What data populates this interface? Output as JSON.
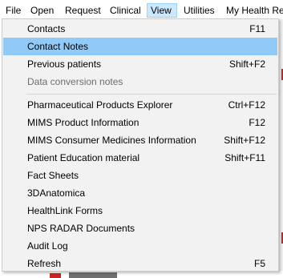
{
  "menubar": {
    "items": [
      "File",
      "Open",
      "Request",
      "Clinical",
      "View",
      "Utilities",
      "My Health Re"
    ]
  },
  "view_menu": {
    "items": [
      {
        "label": "Contacts",
        "shortcut": "F11"
      },
      {
        "label": "Contact Notes",
        "shortcut": ""
      },
      {
        "label": "Previous patients",
        "shortcut": "Shift+F2"
      },
      {
        "label": "Data conversion notes",
        "shortcut": ""
      },
      {
        "label": "Pharmaceutical Products Explorer",
        "shortcut": "Ctrl+F12"
      },
      {
        "label": "MIMS Product Information",
        "shortcut": "F12"
      },
      {
        "label": "MIMS Consumer Medicines Information",
        "shortcut": "Shift+F12"
      },
      {
        "label": "Patient Education material",
        "shortcut": "Shift+F11"
      },
      {
        "label": "Fact Sheets",
        "shortcut": ""
      },
      {
        "label": "3DAnatomica",
        "shortcut": ""
      },
      {
        "label": "HealthLink Forms",
        "shortcut": ""
      },
      {
        "label": "NPS RADAR Documents",
        "shortcut": ""
      },
      {
        "label": "Audit Log",
        "shortcut": ""
      },
      {
        "label": "Refresh",
        "shortcut": "F5"
      }
    ]
  },
  "colors": {
    "highlight": "#91c9f7",
    "active_menu": "#cce8ff",
    "disabled_text": "#6d6d6d"
  }
}
